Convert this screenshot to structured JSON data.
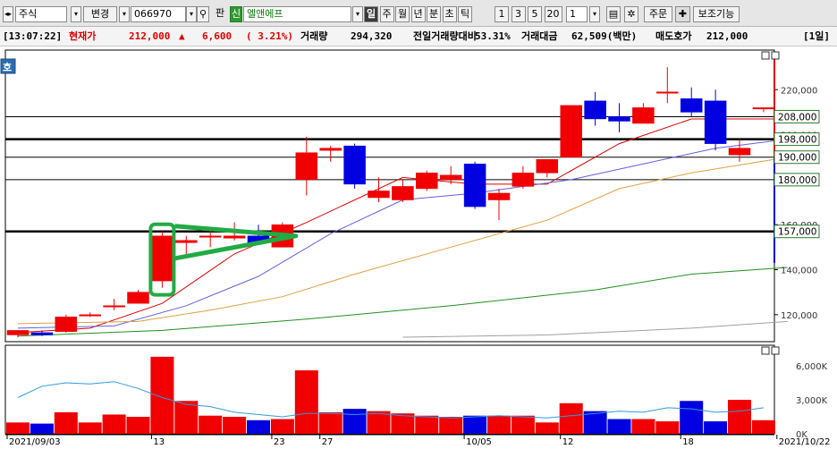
{
  "toolbar": {
    "market": "주식",
    "change": "변경",
    "code": "066970",
    "pan_label": "판",
    "new_badge": "신",
    "name": "엘앤에프",
    "periods": [
      "일",
      "주",
      "월",
      "년",
      "분",
      "초",
      "틱"
    ],
    "intervals": [
      "1",
      "3",
      "5",
      "20"
    ],
    "count_value": "1",
    "order_label": "주문",
    "aux_label": "보조기능"
  },
  "info": {
    "time": "[13:07:22]",
    "price_label": "현재가",
    "price": "212,000",
    "change_arrow": "▲",
    "change": "6,600",
    "change_pct": "( 3.21%)",
    "volume_label": "거래량",
    "volume": "294,320",
    "prev_ratio_label": "전일거래량대비",
    "prev_ratio": "53.31%",
    "amount_label": "거래대금",
    "amount": "62,509(백만)",
    "ask_label": "매도호가",
    "ask": "212,000",
    "period": "[1일]"
  },
  "side_button": "호",
  "colors": {
    "up": "#f00000",
    "down": "#0000e0",
    "ma5": "#e00000",
    "ma10": "#6060e0",
    "ma20": "#e0a040",
    "ma60": "#209020",
    "ma120": "#a0a0a0",
    "annotation": "#22aa44"
  },
  "chart_data": {
    "type": "candlestick",
    "price_axis_labels": [
      "220,000",
      "200,000",
      "180,000",
      "160,000",
      "140,000",
      "120,000"
    ],
    "price_ticks": [
      220000,
      200000,
      180000,
      160000,
      140000,
      120000
    ],
    "price_range": [
      108000,
      236000
    ],
    "hlines": [
      {
        "value": 208000,
        "label": "208,000",
        "bold": false
      },
      {
        "value": 198000,
        "label": "198,000",
        "bold": true
      },
      {
        "value": 190000,
        "label": "190,000",
        "bold": false
      },
      {
        "value": 180000,
        "label": "180,000",
        "bold": false
      },
      {
        "value": 157000,
        "label": "157,000",
        "bold": true
      }
    ],
    "x_labels": [
      {
        "i": 0,
        "text": "2021/09/03"
      },
      {
        "i": 6,
        "text": "13"
      },
      {
        "i": 11,
        "text": "23"
      },
      {
        "i": 13,
        "text": "27"
      },
      {
        "i": 19,
        "text": "10/05"
      },
      {
        "i": 23,
        "text": "12"
      },
      {
        "i": 28,
        "text": "18"
      },
      {
        "i": 32,
        "text": "2021/10/22"
      }
    ],
    "candles": [
      {
        "o": 111000,
        "h": 113000,
        "l": 110000,
        "c": 113000,
        "v": 1000
      },
      {
        "o": 112000,
        "h": 113000,
        "l": 110500,
        "c": 111000,
        "v": 900
      },
      {
        "o": 112500,
        "h": 120000,
        "l": 112000,
        "c": 119000,
        "v": 1900
      },
      {
        "o": 120000,
        "h": 121000,
        "l": 119000,
        "c": 120000,
        "v": 1000
      },
      {
        "o": 124000,
        "h": 127000,
        "l": 122000,
        "c": 124000,
        "v": 1700
      },
      {
        "o": 125000,
        "h": 131000,
        "l": 125000,
        "c": 130000,
        "v": 1500
      },
      {
        "o": 135000,
        "h": 157000,
        "l": 132000,
        "c": 155000,
        "v": 6800
      },
      {
        "o": 152000,
        "h": 155000,
        "l": 145000,
        "c": 153000,
        "v": 2900
      },
      {
        "o": 155000,
        "h": 158000,
        "l": 150000,
        "c": 155000,
        "v": 1600
      },
      {
        "o": 154000,
        "h": 161000,
        "l": 153000,
        "c": 155000,
        "v": 1500
      },
      {
        "o": 155000,
        "h": 160000,
        "l": 151000,
        "c": 152000,
        "v": 1200
      },
      {
        "o": 150000,
        "h": 161000,
        "l": 150000,
        "c": 160000,
        "v": 1300
      },
      {
        "o": 180000,
        "h": 199000,
        "l": 173000,
        "c": 192000,
        "v": 5600
      },
      {
        "o": 193000,
        "h": 195000,
        "l": 188000,
        "c": 194000,
        "v": 1900
      },
      {
        "o": 195000,
        "h": 196000,
        "l": 176000,
        "c": 178000,
        "v": 2200
      },
      {
        "o": 172000,
        "h": 181000,
        "l": 170000,
        "c": 175000,
        "v": 2000
      },
      {
        "o": 171000,
        "h": 180000,
        "l": 170000,
        "c": 177000,
        "v": 1800
      },
      {
        "o": 176000,
        "h": 184000,
        "l": 175000,
        "c": 183000,
        "v": 1600
      },
      {
        "o": 180000,
        "h": 186000,
        "l": 178000,
        "c": 182000,
        "v": 1500
      },
      {
        "o": 187000,
        "h": 188000,
        "l": 167000,
        "c": 168000,
        "v": 1600
      },
      {
        "o": 171000,
        "h": 176000,
        "l": 162000,
        "c": 174000,
        "v": 1600
      },
      {
        "o": 177000,
        "h": 186000,
        "l": 176000,
        "c": 183000,
        "v": 1600
      },
      {
        "o": 183000,
        "h": 188000,
        "l": 181000,
        "c": 189000,
        "v": 1000
      },
      {
        "o": 190000,
        "h": 213000,
        "l": 190000,
        "c": 213000,
        "v": 2700
      },
      {
        "o": 215000,
        "h": 219000,
        "l": 204000,
        "c": 207000,
        "v": 2000
      },
      {
        "o": 208000,
        "h": 214000,
        "l": 201000,
        "c": 206000,
        "v": 1300
      },
      {
        "o": 205000,
        "h": 214000,
        "l": 205000,
        "c": 212000,
        "v": 1300
      },
      {
        "o": 219000,
        "h": 230000,
        "l": 214000,
        "c": 219000,
        "v": 1100
      },
      {
        "o": 216000,
        "h": 221000,
        "l": 208000,
        "c": 210000,
        "v": 2900
      },
      {
        "o": 215000,
        "h": 220000,
        "l": 193000,
        "c": 196000,
        "v": 1100
      },
      {
        "o": 191000,
        "h": 198000,
        "l": 188000,
        "c": 194000,
        "v": 3000
      },
      {
        "o": 212000,
        "h": 212000,
        "l": 210000,
        "c": 212000,
        "v": 1200
      }
    ],
    "ma": [
      {
        "name": "ma5",
        "values": [
          [
            0,
            112000
          ],
          [
            3,
            114000
          ],
          [
            6,
            125000
          ],
          [
            9,
            147000
          ],
          [
            12,
            161000
          ],
          [
            16,
            181000
          ],
          [
            19,
            178000
          ],
          [
            22,
            178000
          ],
          [
            25,
            196000
          ],
          [
            28,
            207000
          ],
          [
            32,
            207000
          ]
        ]
      },
      {
        "name": "ma10",
        "values": [
          [
            0,
            114000
          ],
          [
            4,
            115000
          ],
          [
            7,
            124000
          ],
          [
            10,
            137000
          ],
          [
            13,
            156000
          ],
          [
            16,
            171000
          ],
          [
            19,
            174000
          ],
          [
            23,
            180000
          ],
          [
            26,
            187000
          ],
          [
            29,
            194000
          ],
          [
            32,
            198000
          ]
        ]
      },
      {
        "name": "ma20",
        "values": [
          [
            0,
            116000
          ],
          [
            5,
            117000
          ],
          [
            8,
            122000
          ],
          [
            11,
            128000
          ],
          [
            14,
            138000
          ],
          [
            18,
            150000
          ],
          [
            22,
            162000
          ],
          [
            25,
            176000
          ],
          [
            28,
            183000
          ],
          [
            32,
            190000
          ]
        ]
      },
      {
        "name": "ma60",
        "values": [
          [
            0,
            110500
          ],
          [
            6,
            113000
          ],
          [
            12,
            118000
          ],
          [
            18,
            124000
          ],
          [
            24,
            131000
          ],
          [
            28,
            138000
          ],
          [
            32,
            141000
          ]
        ]
      },
      {
        "name": "ma120",
        "values": [
          [
            16,
            110000
          ],
          [
            22,
            111000
          ],
          [
            28,
            114000
          ],
          [
            32,
            117000
          ]
        ]
      }
    ],
    "volume_axis_labels": [
      "6,000K",
      "3,000K",
      "0K"
    ],
    "volume_ticks": [
      6000,
      3000,
      0
    ],
    "volume_range": [
      0,
      7500
    ],
    "volume_avg": [
      3200,
      4200,
      4500,
      4400,
      4600,
      4000,
      3200,
      2600,
      2400,
      1900,
      1700,
      1500,
      1800,
      1800,
      1700,
      1800,
      1600,
      1500,
      1400,
      1500,
      1600,
      1500,
      1400,
      1600,
      1800,
      2000,
      1900,
      2300,
      2200,
      1900,
      2000,
      2300
    ]
  }
}
